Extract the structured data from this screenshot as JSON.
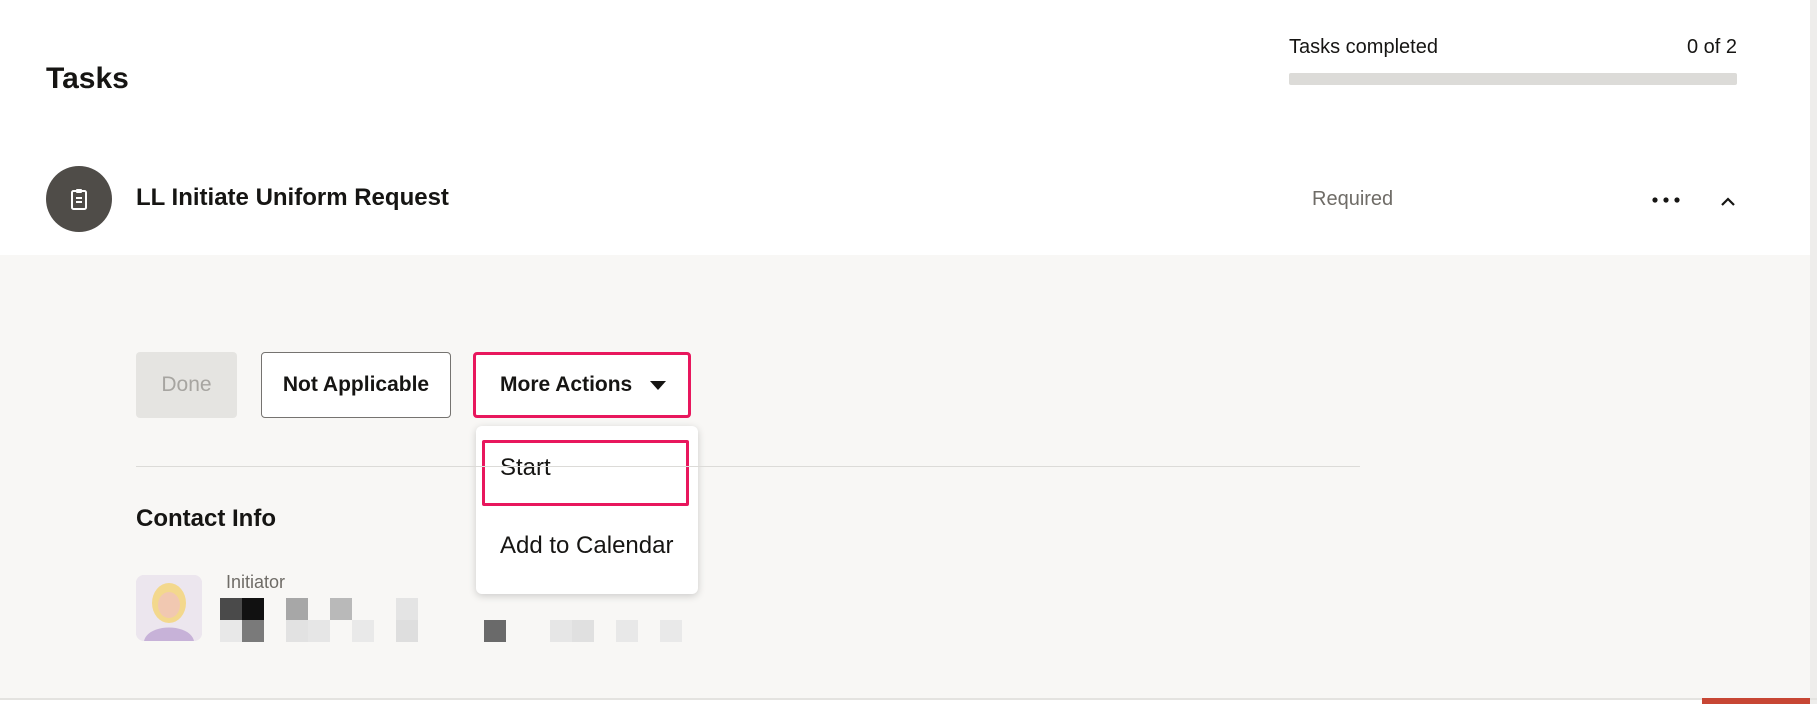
{
  "header": {
    "title": "Tasks",
    "progress_label": "Tasks completed",
    "progress_count": "0 of 2",
    "progress_fraction": 0
  },
  "task": {
    "title": "LL Initiate Uniform Request",
    "status": "Required",
    "icon": "clipboard-icon",
    "more_icon": "more-horizontal-icon",
    "collapse_icon": "chevron-up-icon"
  },
  "actions": {
    "done_label": "Done",
    "not_applicable_label": "Not Applicable",
    "more_actions_label": "More Actions"
  },
  "more_actions_menu": {
    "items": [
      "Start",
      "Add to Calendar"
    ],
    "highlighted": "Start"
  },
  "contact": {
    "title": "Contact Info",
    "role_label": "Initiator"
  },
  "colors": {
    "highlight": "#e8175d",
    "panel_bg": "#f8f7f5",
    "icon_circle": "#4f4c48",
    "accent_bar": "#c74634"
  }
}
